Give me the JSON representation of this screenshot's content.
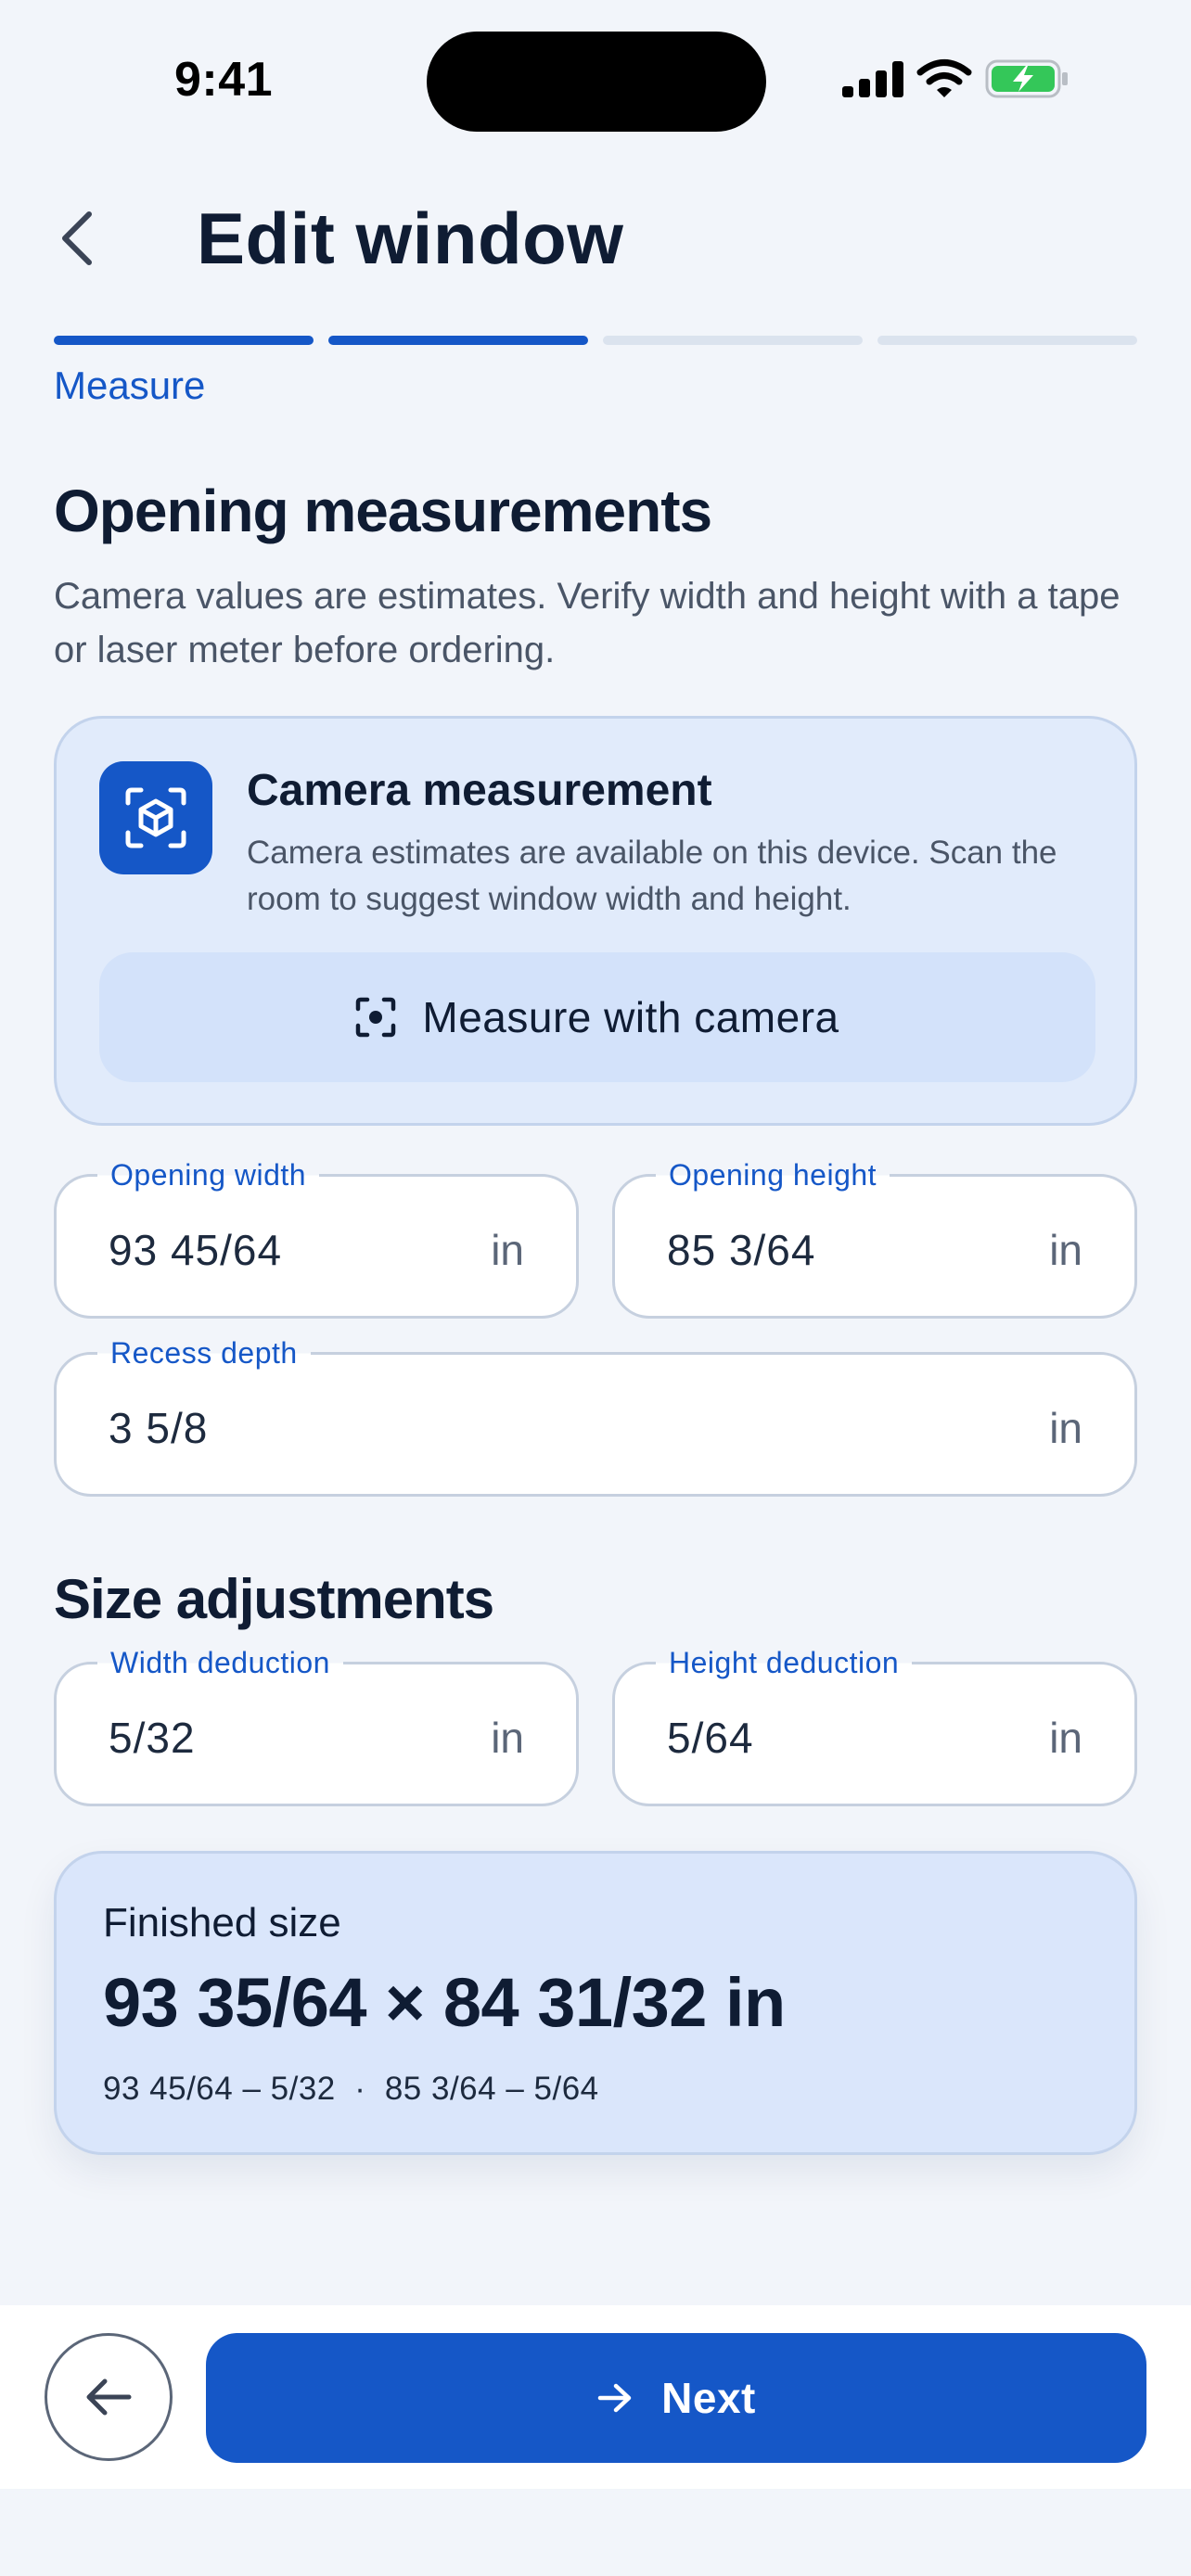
{
  "status_bar": {
    "time": "9:41",
    "icons": [
      "signal-icon",
      "wifi-icon",
      "battery-charging-icon"
    ],
    "battery_color": "#34c759"
  },
  "header": {
    "title": "Edit window",
    "back_icon": "chevron-left-icon"
  },
  "stepper": {
    "total_steps": 4,
    "completed_steps": 2,
    "current_label": "Measure",
    "active_color": "#1557c7",
    "inactive_color": "#dbe3ee"
  },
  "opening": {
    "title": "Opening measurements",
    "description": "Camera values are estimates. Verify width and height with a tape or laser meter before ordering."
  },
  "camera_card": {
    "icon": "ar-cube-icon",
    "title": "Camera measurement",
    "description": "Camera estimates are available on this device. Scan the room to suggest window width and height.",
    "button_icon": "camera-focus-icon",
    "button_label": "Measure with camera"
  },
  "fields": {
    "opening_width": {
      "label": "Opening width",
      "value": "93 45/64",
      "unit": "in"
    },
    "opening_height": {
      "label": "Opening height",
      "value": "85 3/64",
      "unit": "in"
    },
    "recess_depth": {
      "label": "Recess depth",
      "value": "3 5/8",
      "unit": "in"
    }
  },
  "adjustments": {
    "title": "Size adjustments",
    "width_deduction": {
      "label": "Width deduction",
      "value": "5/32",
      "unit": "in"
    },
    "height_deduction": {
      "label": "Height deduction",
      "value": "5/64",
      "unit": "in"
    }
  },
  "finished": {
    "label": "Finished size",
    "value": "93 35/64 × 84 31/32 in",
    "calculation": "93 45/64 – 5/32  ·  85 3/64 – 5/64"
  },
  "footer": {
    "back_icon": "arrow-left-icon",
    "next_icon": "arrow-right-icon",
    "next_label": "Next",
    "primary_color": "#1557c7"
  }
}
